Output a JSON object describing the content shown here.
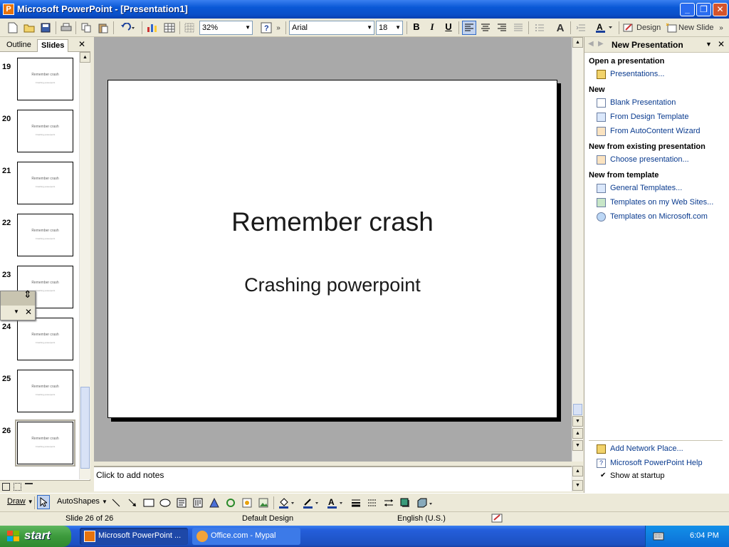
{
  "window": {
    "app_icon_letter": "P",
    "title": "Microsoft PowerPoint - [Presentation1]",
    "minimize": "_",
    "restore": "❐",
    "close": "✕"
  },
  "toolbar": {
    "zoom": "32%",
    "font": "Arial",
    "font_size": "18",
    "bold": "B",
    "italic": "I",
    "underline": "U",
    "design_label": "Design",
    "new_slide_label": "New Slide"
  },
  "left_panel": {
    "tab_outline": "Outline",
    "tab_slides": "Slides",
    "close": "✕",
    "slides": [
      {
        "num": "19",
        "title": "Remember crash",
        "subtitle": "Crashing powerpoint"
      },
      {
        "num": "20",
        "title": "Remember crash",
        "subtitle": "Crashing powerpoint"
      },
      {
        "num": "21",
        "title": "Remember crash",
        "subtitle": "Crashing powerpoint"
      },
      {
        "num": "22",
        "title": "Remember crash",
        "subtitle": "Crashing powerpoint"
      },
      {
        "num": "23",
        "title": "Remember crash",
        "subtitle": "Crashing powerpoint"
      },
      {
        "num": "24",
        "title": "Remember crash",
        "subtitle": "Crashing powerpoint"
      },
      {
        "num": "25",
        "title": "Remember crash",
        "subtitle": "Crashing powerpoint"
      },
      {
        "num": "26",
        "title": "Remember crash",
        "subtitle": "Crashing powerpoint"
      }
    ]
  },
  "slide": {
    "title": "Remember crash",
    "subtitle": "Crashing powerpoint"
  },
  "notes_placeholder": "Click to add notes",
  "task_pane": {
    "title": "New Presentation",
    "sections": [
      {
        "heading": "Open a presentation",
        "items": [
          "Presentations..."
        ]
      },
      {
        "heading": "New",
        "items": [
          "Blank Presentation",
          "From Design Template",
          "From AutoContent Wizard"
        ]
      },
      {
        "heading": "New from existing presentation",
        "items": [
          "Choose presentation..."
        ]
      },
      {
        "heading": "New from template",
        "items": [
          "General Templates...",
          "Templates on my Web Sites...",
          "Templates on Microsoft.com"
        ]
      }
    ],
    "footer": {
      "add_network_place": "Add Network Place...",
      "help": "Microsoft PowerPoint Help",
      "show_at_startup": "Show at startup"
    }
  },
  "draw_toolbar": {
    "draw_label": "Draw",
    "autoshapes_label": "AutoShapes"
  },
  "status_bar": {
    "slide_info": "Slide 26 of 26",
    "design": "Default Design",
    "language": "English (U.S.)"
  },
  "taskbar": {
    "start_label": "start",
    "tasks": [
      "Microsoft PowerPoint ...",
      "Office.com - Mypal"
    ],
    "clock": "6:04 PM"
  },
  "colors": {
    "titlebar": "#0a58d6",
    "chrome": "#ece9d8",
    "link": "#0a3b8f",
    "taskbar": "#245edb",
    "start": "#3c9a3c"
  }
}
